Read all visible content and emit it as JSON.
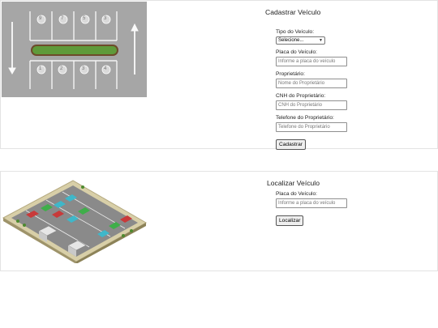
{
  "cadastro": {
    "title": "Cadastrar Veículo",
    "tipo_label": "Tipo do Veículo:",
    "tipo_selected": "Selecione...",
    "placa_label": "Placa do Veículo:",
    "placa_placeholder": "Informe a placa do veículo",
    "proprietario_label": "Proprietário:",
    "proprietario_placeholder": "Nome do Proprietário",
    "cnh_label": "CNH do Proprietário:",
    "cnh_placeholder": "CNH do Proprietário",
    "telefone_label": "Telefone do Proprietário:",
    "telefone_placeholder": "Telefone do Proprietário",
    "submit_label": "Cadastrar",
    "image_icon": "parking-lot-top-view-image"
  },
  "localizar": {
    "title": "Localizar Veículo",
    "placa_label": "Placa do Veículo:",
    "placa_placeholder": "Informe a placa do veículo",
    "submit_label": "Localizar",
    "image_icon": "parking-lot-isometric-image"
  },
  "parking": {
    "top_spots": [
      "9",
      "7",
      "5",
      "3"
    ],
    "bottom_spots": [
      "1",
      "2",
      "3",
      "4"
    ]
  }
}
